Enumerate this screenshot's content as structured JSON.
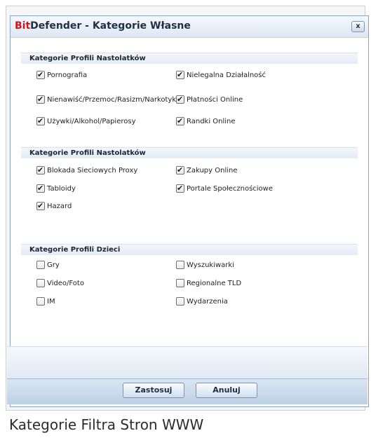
{
  "window": {
    "brand": "Bit",
    "title": "Defender - Kategorie Własne",
    "close_symbol": "x"
  },
  "sections": [
    {
      "header": "Kategorie Profili Nastolatków",
      "items": [
        {
          "label": "Pornografia",
          "checked": true
        },
        {
          "label": "Nielegalna Działalność",
          "checked": true
        },
        {
          "label": "Nienawiść/Przemoc/Rasizm/Narkotyki",
          "checked": true
        },
        {
          "label": "Płatności Online",
          "checked": true
        },
        {
          "label": "Używki/Alkohol/Papierosy",
          "checked": true
        },
        {
          "label": "Randki Online",
          "checked": true
        }
      ]
    },
    {
      "header": "Kategorie Profili Nastolatków",
      "items": [
        {
          "label": "Blokada Sieciowych Proxy",
          "checked": true
        },
        {
          "label": "Zakupy Online",
          "checked": true
        },
        {
          "label": "Tabloidy",
          "checked": true
        },
        {
          "label": "Portale Społecznościowe",
          "checked": true
        },
        {
          "label": "Hazard",
          "checked": true
        }
      ]
    },
    {
      "header": "Kategorie Profili Dzieci",
      "items": [
        {
          "label": "Gry",
          "checked": false
        },
        {
          "label": "Wyszukiwarki",
          "checked": false
        },
        {
          "label": "Video/Foto",
          "checked": false
        },
        {
          "label": "Regionalne TLD",
          "checked": false
        },
        {
          "label": "IM",
          "checked": false
        },
        {
          "label": "Wydarzenia",
          "checked": false
        }
      ]
    }
  ],
  "buttons": {
    "apply": "Zastosuj",
    "cancel": "Anuluj"
  },
  "caption": "Kategorie Filtra Stron WWW"
}
